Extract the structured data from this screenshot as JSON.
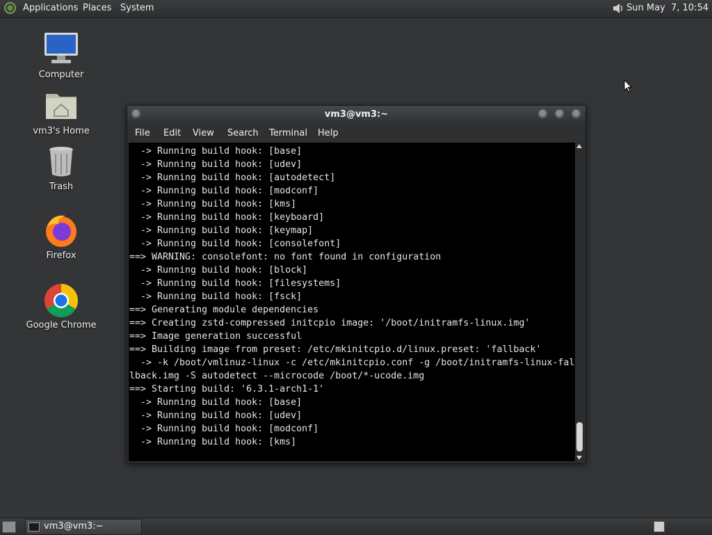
{
  "top_panel": {
    "menu": [
      "Applications",
      "Places",
      "System"
    ],
    "clock": "Sun May  7, 10:54"
  },
  "desktop": {
    "icons": [
      {
        "label": "Computer",
        "icon": "computer-icon"
      },
      {
        "label": "vm3's Home",
        "icon": "home-folder-icon"
      },
      {
        "label": "Trash",
        "icon": "trash-icon"
      },
      {
        "label": "Firefox",
        "icon": "firefox-icon"
      },
      {
        "label": "Google Chrome",
        "icon": "chrome-icon"
      }
    ]
  },
  "terminal": {
    "title": "vm3@vm3:~",
    "menu": [
      "File",
      "Edit",
      "View",
      "Search",
      "Terminal",
      "Help"
    ],
    "lines": [
      "  -> Running build hook: [base]",
      "  -> Running build hook: [udev]",
      "  -> Running build hook: [autodetect]",
      "  -> Running build hook: [modconf]",
      "  -> Running build hook: [kms]",
      "  -> Running build hook: [keyboard]",
      "  -> Running build hook: [keymap]",
      "  -> Running build hook: [consolefont]",
      "==> WARNING: consolefont: no font found in configuration",
      "  -> Running build hook: [block]",
      "  -> Running build hook: [filesystems]",
      "  -> Running build hook: [fsck]",
      "==> Generating module dependencies",
      "==> Creating zstd-compressed initcpio image: '/boot/initramfs-linux.img'",
      "==> Image generation successful",
      "==> Building image from preset: /etc/mkinitcpio.d/linux.preset: 'fallback'",
      "  -> -k /boot/vmlinuz-linux -c /etc/mkinitcpio.conf -g /boot/initramfs-linux-fal",
      "lback.img -S autodetect --microcode /boot/*-ucode.img",
      "==> Starting build: '6.3.1-arch1-1'",
      "  -> Running build hook: [base]",
      "  -> Running build hook: [udev]",
      "  -> Running build hook: [modconf]",
      "  -> Running build hook: [kms]"
    ]
  },
  "taskbar": {
    "task_label": "vm3@vm3:~"
  },
  "colors": {
    "desktop_bg": "#333537",
    "terminal_bg": "#000000",
    "terminal_fg": "#e6e6e6"
  }
}
